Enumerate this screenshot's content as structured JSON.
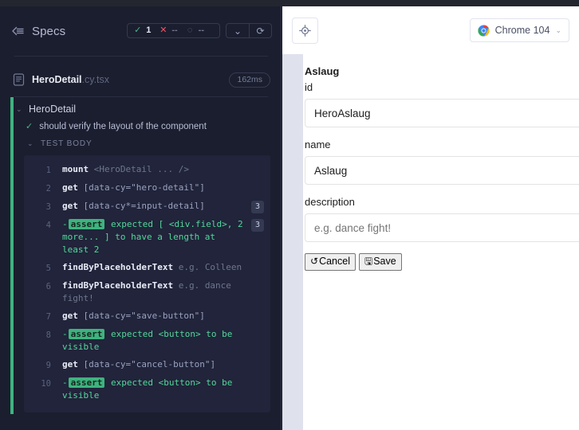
{
  "reporter": {
    "header": {
      "collapse_icon": "collapse-left-icon",
      "title": "Specs",
      "stats": {
        "passed_glyph": "✓",
        "passed": "1",
        "failed_glyph": "✕",
        "failed": "--",
        "pending_glyph": "◌",
        "pending": "--"
      },
      "controls": [
        {
          "name": "chevron-down-icon",
          "glyph": "⌄"
        },
        {
          "name": "reload-icon",
          "glyph": "⟳"
        }
      ]
    },
    "spec": {
      "icon": "file-icon",
      "name": "HeroDetail",
      "ext": ".cy.tsx",
      "duration": "162ms"
    },
    "suite": {
      "chevron": "⌄",
      "title": "HeroDetail"
    },
    "test": {
      "check": "✓",
      "title": "should verify the layout of the component"
    },
    "section": {
      "chevron": "⌄",
      "label": "TEST BODY"
    },
    "commands": [
      {
        "num": "1",
        "method": "mount",
        "arg": "<HeroDetail ... />",
        "arg_dim": true,
        "count": "",
        "assert": false
      },
      {
        "num": "2",
        "method": "get",
        "arg": "[data-cy=\"hero-detail\"]",
        "arg_dim": false,
        "count": "",
        "assert": false
      },
      {
        "num": "3",
        "method": "get",
        "arg": "[data-cy*=input-detail]",
        "arg_dim": false,
        "count": "3",
        "assert": false
      },
      {
        "num": "4",
        "method": "assert",
        "arg": "expected [ <div.field>, 2 more... ] to have a length at least 2",
        "arg_dim": false,
        "count": "3",
        "assert": true
      },
      {
        "num": "5",
        "method": "findByPlaceholderText",
        "arg": "e.g. Colleen",
        "arg_dim": true,
        "count": "",
        "assert": false
      },
      {
        "num": "6",
        "method": "findByPlaceholderText",
        "arg": "e.g. dance fight!",
        "arg_dim": true,
        "count": "",
        "assert": false
      },
      {
        "num": "7",
        "method": "get",
        "arg": "[data-cy=\"save-button\"]",
        "arg_dim": false,
        "count": "",
        "assert": false
      },
      {
        "num": "8",
        "method": "assert",
        "arg": "expected <button> to be visible",
        "arg_dim": false,
        "count": "",
        "assert": true
      },
      {
        "num": "9",
        "method": "get",
        "arg": "[data-cy=\"cancel-button\"]",
        "arg_dim": false,
        "count": "",
        "assert": false
      },
      {
        "num": "10",
        "method": "assert",
        "arg": "expected <button> to be visible",
        "arg_dim": false,
        "count": "",
        "assert": true
      }
    ]
  },
  "aut": {
    "toolbar": {
      "selector_playground_icon": "selector-playground-icon",
      "browser_icon": "chrome-icon",
      "browser_label": "Chrome 104",
      "browser_chevron": "⌄"
    },
    "app": {
      "title": "Aslaug",
      "fields": [
        {
          "label": "id",
          "value": "HeroAslaug",
          "placeholder": "",
          "is_placeholder": false
        },
        {
          "label": "name",
          "value": "Aslaug",
          "placeholder": "e.g. Colleen",
          "is_placeholder": false
        },
        {
          "label": "description",
          "value": "e.g. dance fight!",
          "placeholder": "e.g. dance fight!",
          "is_placeholder": true
        }
      ],
      "buttons": [
        {
          "glyph": "↺",
          "label": "Cancel",
          "name": "cancel-button"
        },
        {
          "glyph": "🖫",
          "label": "Save",
          "name": "save-button"
        }
      ]
    }
  },
  "colors": {
    "pass_green": "#3eb37f",
    "fail_red": "#e45b6c",
    "panel_bg": "#1b1e2e",
    "cmd_bg": "#21243a",
    "stage_bg": "#dfe2ec"
  }
}
